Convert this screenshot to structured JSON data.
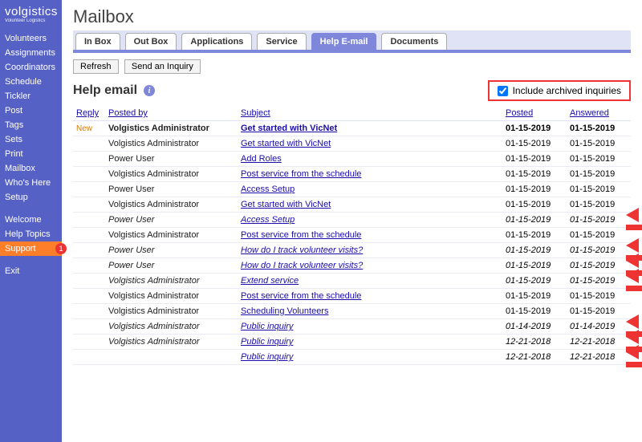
{
  "brand": {
    "name": "volgistics",
    "tagline": "Volunteer Logistics"
  },
  "sidebar": {
    "items": [
      {
        "label": "Volunteers"
      },
      {
        "label": "Assignments"
      },
      {
        "label": "Coordinators"
      },
      {
        "label": "Schedule"
      },
      {
        "label": "Tickler"
      },
      {
        "label": "Post"
      },
      {
        "label": "Tags"
      },
      {
        "label": "Sets"
      },
      {
        "label": "Print"
      },
      {
        "label": "Mailbox"
      },
      {
        "label": "Who's Here"
      },
      {
        "label": "Setup"
      }
    ],
    "secondary": [
      {
        "label": "Welcome"
      },
      {
        "label": "Help Topics"
      },
      {
        "label": "Support",
        "selected": true,
        "badge": "1"
      }
    ],
    "tertiary": [
      {
        "label": "Exit"
      }
    ]
  },
  "page": {
    "title": "Mailbox"
  },
  "tabs": [
    {
      "label": "In Box"
    },
    {
      "label": "Out Box"
    },
    {
      "label": "Applications"
    },
    {
      "label": "Service"
    },
    {
      "label": "Help E-mail",
      "active": true
    },
    {
      "label": "Documents"
    }
  ],
  "toolbar": {
    "refresh": "Refresh",
    "send_inquiry": "Send an Inquiry"
  },
  "section": {
    "title": "Help email",
    "archive_label": "Include archived inquiries",
    "archive_checked": true
  },
  "columns": {
    "reply": "Reply",
    "posted_by": "Posted by",
    "subject": "Subject",
    "posted": "Posted",
    "answered": "Answered"
  },
  "rows": [
    {
      "new": true,
      "archived": false,
      "posted_by": "Volgistics Administrator",
      "subject": "Get started with VicNet",
      "posted": "01-15-2019",
      "answered": "01-15-2019",
      "arrow": false
    },
    {
      "new": false,
      "archived": false,
      "posted_by": "Volgistics Administrator",
      "subject": "Get started with VicNet",
      "posted": "01-15-2019",
      "answered": "01-15-2019",
      "arrow": false
    },
    {
      "new": false,
      "archived": false,
      "posted_by": "Power User",
      "subject": "Add Roles",
      "posted": "01-15-2019",
      "answered": "01-15-2019",
      "arrow": false
    },
    {
      "new": false,
      "archived": false,
      "posted_by": "Volgistics Administrator",
      "subject": "Post service from the schedule",
      "posted": "01-15-2019",
      "answered": "01-15-2019",
      "arrow": false
    },
    {
      "new": false,
      "archived": false,
      "posted_by": "Power User",
      "subject": "Access Setup",
      "posted": "01-15-2019",
      "answered": "01-15-2019",
      "arrow": false
    },
    {
      "new": false,
      "archived": false,
      "posted_by": "Volgistics Administrator",
      "subject": "Get started with VicNet",
      "posted": "01-15-2019",
      "answered": "01-15-2019",
      "arrow": false
    },
    {
      "new": false,
      "archived": true,
      "posted_by": "Power User",
      "subject": "Access Setup",
      "posted": "01-15-2019",
      "answered": "01-15-2019",
      "arrow": true
    },
    {
      "new": false,
      "archived": false,
      "posted_by": "Volgistics Administrator",
      "subject": "Post service from the schedule",
      "posted": "01-15-2019",
      "answered": "01-15-2019",
      "arrow": false
    },
    {
      "new": false,
      "archived": true,
      "posted_by": "Power User",
      "subject": "How do I track volunteer visits?",
      "posted": "01-15-2019",
      "answered": "01-15-2019",
      "arrow": true
    },
    {
      "new": false,
      "archived": true,
      "posted_by": "Power User",
      "subject": "How do I track volunteer visits?",
      "posted": "01-15-2019",
      "answered": "01-15-2019",
      "arrow": true
    },
    {
      "new": false,
      "archived": true,
      "posted_by": "Volgistics Administrator",
      "subject": "Extend service",
      "posted": "01-15-2019",
      "answered": "01-15-2019",
      "arrow": true
    },
    {
      "new": false,
      "archived": false,
      "posted_by": "Volgistics Administrator",
      "subject": "Post service from the schedule",
      "posted": "01-15-2019",
      "answered": "01-15-2019",
      "arrow": false
    },
    {
      "new": false,
      "archived": false,
      "posted_by": "Volgistics Administrator",
      "subject": "Scheduling Volunteers",
      "posted": "01-15-2019",
      "answered": "01-15-2019",
      "arrow": false
    },
    {
      "new": false,
      "archived": true,
      "posted_by": "Volgistics Administrator",
      "subject": "Public inquiry",
      "posted": "01-14-2019",
      "answered": "01-14-2019",
      "arrow": true
    },
    {
      "new": false,
      "archived": true,
      "posted_by": "Volgistics Administrator",
      "subject": "Public inquiry",
      "posted": "12-21-2018",
      "answered": "12-21-2018",
      "arrow": true
    },
    {
      "new": false,
      "archived": true,
      "posted_by": "",
      "subject": "Public inquiry",
      "posted": "12-21-2018",
      "answered": "12-21-2018",
      "arrow": true
    }
  ],
  "misc": {
    "new_label": "New"
  }
}
